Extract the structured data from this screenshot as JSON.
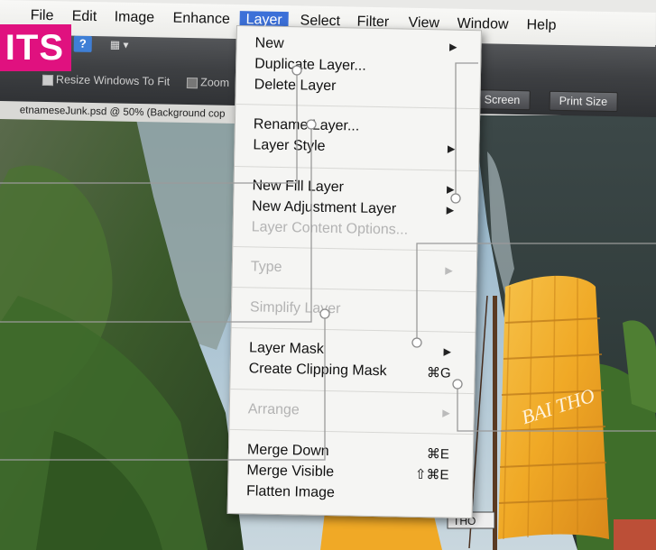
{
  "menubar": {
    "items": [
      {
        "label": "File"
      },
      {
        "label": "Edit"
      },
      {
        "label": "Image"
      },
      {
        "label": "Enhance"
      },
      {
        "label": "Layer"
      },
      {
        "label": "Select"
      },
      {
        "label": "Filter"
      },
      {
        "label": "View"
      },
      {
        "label": "Window"
      },
      {
        "label": "Help"
      }
    ],
    "active_item": "Layer",
    "accent_color": "#3c70d8"
  },
  "badge": {
    "text": "ITS",
    "color": "#e0117f"
  },
  "toolbar": {
    "help_label": "?",
    "resize_windows_label": "Resize Windows To Fit",
    "zoom_label": "Zoom",
    "full_screen_label": "ll Screen",
    "print_size_label": "Print Size"
  },
  "document_tab": {
    "title": "etnameseJunk.psd @ 50% (Background cop"
  },
  "photo": {
    "sail_text": "BAI THO",
    "boat_sign": "THO"
  },
  "layer_menu": {
    "items": [
      {
        "label": "New",
        "submenu": true,
        "enabled": true
      },
      {
        "label": "Duplicate Layer...",
        "enabled": true
      },
      {
        "label": "Delete Layer",
        "enabled": true
      },
      {
        "label": "Rename Layer...",
        "enabled": true
      },
      {
        "label": "Layer Style",
        "submenu": true,
        "enabled": true
      },
      {
        "label": "New Fill Layer",
        "submenu": true,
        "enabled": true
      },
      {
        "label": "New Adjustment Layer",
        "submenu": true,
        "enabled": true
      },
      {
        "label": "Layer Content Options...",
        "enabled": false
      },
      {
        "label": "Type",
        "submenu": true,
        "enabled": false
      },
      {
        "label": "Simplify Layer",
        "enabled": false
      },
      {
        "label": "Layer Mask",
        "submenu": true,
        "enabled": true
      },
      {
        "label": "Create Clipping Mask",
        "shortcut": "⌘G",
        "enabled": true
      },
      {
        "label": "Arrange",
        "submenu": true,
        "enabled": false
      },
      {
        "label": "Merge Down",
        "shortcut": "⌘E",
        "enabled": true
      },
      {
        "label": "Merge Visible",
        "shortcut": "⇧⌘E",
        "enabled": true
      },
      {
        "label": "Flatten Image",
        "enabled": true
      }
    ]
  }
}
